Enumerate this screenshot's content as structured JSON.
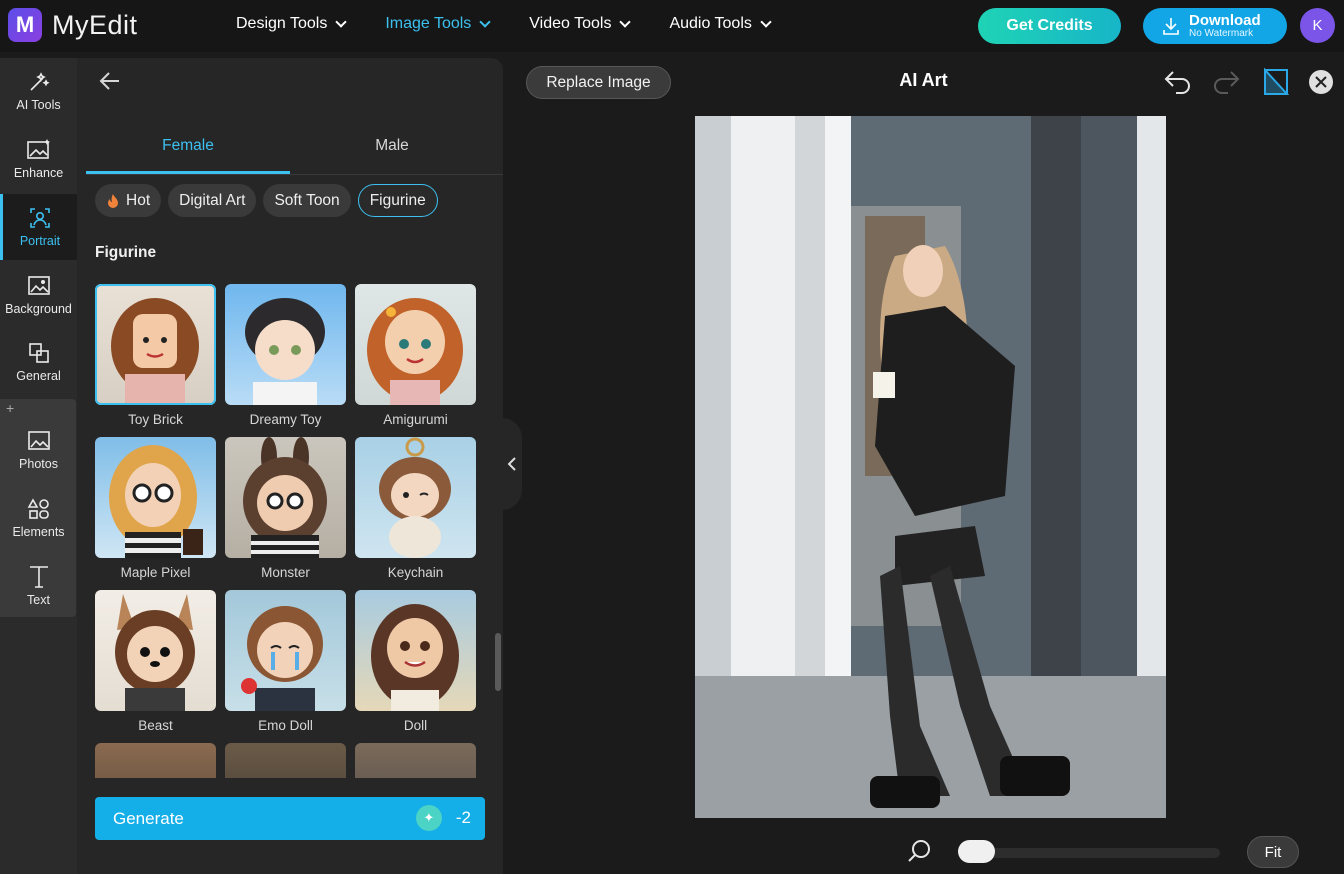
{
  "app": {
    "name": "MyEdit",
    "logo_letter": "M"
  },
  "nav": [
    {
      "label": "Design Tools",
      "active": false
    },
    {
      "label": "Image Tools",
      "active": true
    },
    {
      "label": "Video Tools",
      "active": false
    },
    {
      "label": "Audio Tools",
      "active": false
    }
  ],
  "header": {
    "credits_label": "Get Credits",
    "download_label": "Download",
    "download_sub": "No Watermark",
    "avatar_letter": "K"
  },
  "rail": [
    {
      "label": "AI Tools",
      "icon": "magic-wand-icon",
      "active": false
    },
    {
      "label": "Enhance",
      "icon": "enhance-image-icon",
      "active": false
    },
    {
      "label": "Portrait",
      "icon": "portrait-icon",
      "active": true
    },
    {
      "label": "Background",
      "icon": "background-icon",
      "active": false
    },
    {
      "label": "General",
      "icon": "general-icon",
      "active": false
    },
    {
      "label": "Photos",
      "icon": "photos-icon",
      "active": false
    },
    {
      "label": "Elements",
      "icon": "elements-icon",
      "active": false
    },
    {
      "label": "Text",
      "icon": "text-icon",
      "active": false
    }
  ],
  "rail_plus": "+",
  "panel": {
    "tabs": [
      {
        "label": "Female",
        "active": true
      },
      {
        "label": "Male",
        "active": false
      }
    ],
    "chips": [
      {
        "label": "Hot",
        "icon": "flame-icon",
        "active": false
      },
      {
        "label": "Digital Art",
        "active": false
      },
      {
        "label": "Soft Toon",
        "active": false
      },
      {
        "label": "Figurine",
        "active": true
      }
    ],
    "section_title": "Figurine",
    "styles": [
      {
        "label": "Toy Brick",
        "selected": true
      },
      {
        "label": "Dreamy Toy",
        "selected": false
      },
      {
        "label": "Amigurumi",
        "selected": false
      },
      {
        "label": "Maple Pixel",
        "selected": false
      },
      {
        "label": "Monster",
        "selected": false
      },
      {
        "label": "Keychain",
        "selected": false
      },
      {
        "label": "Beast",
        "selected": false
      },
      {
        "label": "Emo Doll",
        "selected": false
      },
      {
        "label": "Doll",
        "selected": false
      }
    ],
    "generate_label": "Generate",
    "generate_cost": "-2"
  },
  "canvas": {
    "title": "AI Art",
    "replace_label": "Replace Image",
    "fit_label": "Fit",
    "zoom_level": 0
  }
}
